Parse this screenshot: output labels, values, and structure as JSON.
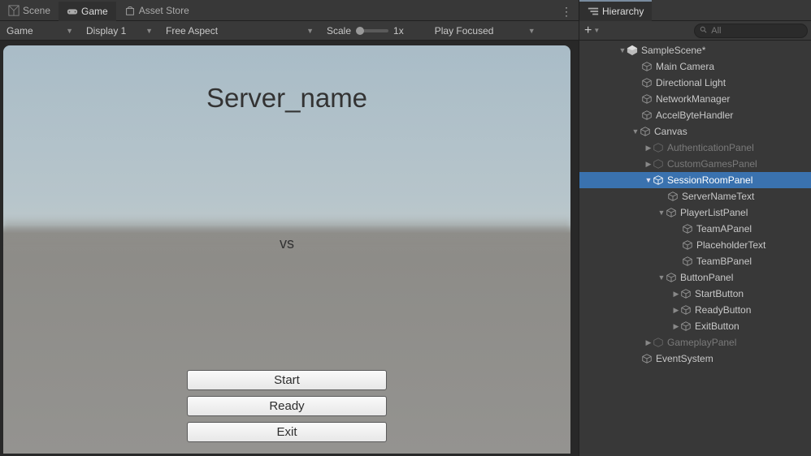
{
  "tabs": {
    "scene": "Scene",
    "game": "Game",
    "asset_store": "Asset Store"
  },
  "toolbar": {
    "game_dropdown": "Game",
    "display": "Display 1",
    "aspect": "Free Aspect",
    "scale_label": "Scale",
    "scale_value": "1x",
    "play_focus": "Play Focused"
  },
  "game_view": {
    "server_title": "Server_name",
    "vs": "vs",
    "buttons": {
      "start": "Start",
      "ready": "Ready",
      "exit": "Exit"
    }
  },
  "hierarchy": {
    "tab_label": "Hierarchy",
    "search_placeholder": "All",
    "tree": {
      "scene": "SampleScene*",
      "main_camera": "Main Camera",
      "directional_light": "Directional Light",
      "network_manager": "NetworkManager",
      "accelbyte_handler": "AccelByteHandler",
      "canvas": "Canvas",
      "authentication_panel": "AuthenticationPanel",
      "custom_games_panel": "CustomGamesPanel",
      "session_room_panel": "SessionRoomPanel",
      "server_name_text": "ServerNameText",
      "player_list_panel": "PlayerListPanel",
      "team_a_panel": "TeamAPanel",
      "placeholder_text": "PlaceholderText",
      "team_b_panel": "TeamBPanel",
      "button_panel": "ButtonPanel",
      "start_button": "StartButton",
      "ready_button": "ReadyButton",
      "exit_button": "ExitButton",
      "gameplay_panel": "GameplayPanel",
      "event_system": "EventSystem"
    }
  }
}
